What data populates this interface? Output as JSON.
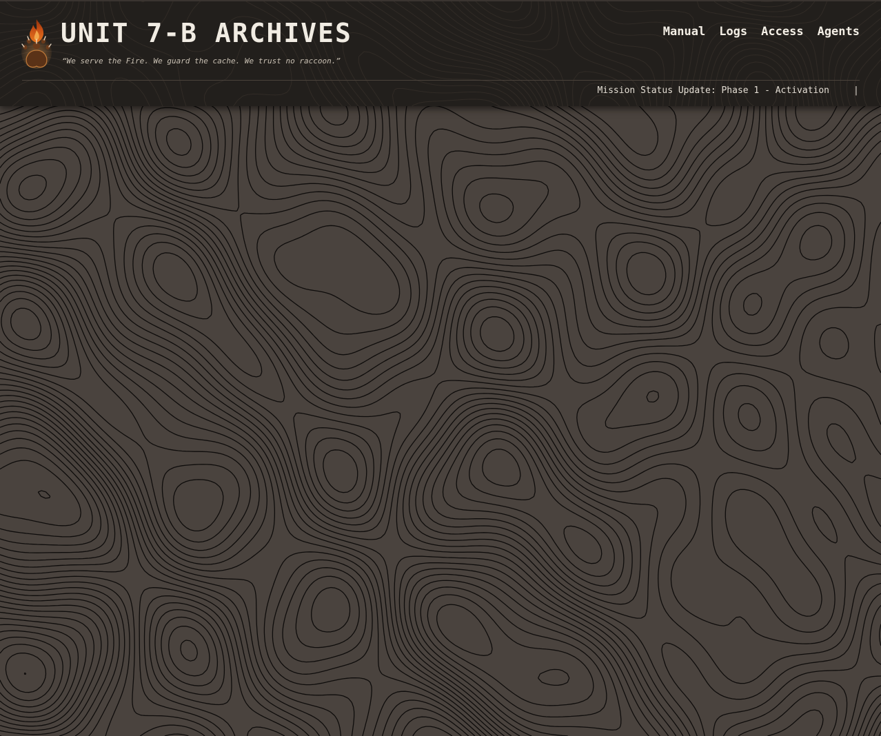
{
  "header": {
    "title": "UNIT 7-B ARCHIVES",
    "tagline": "“We serve the Fire. We guard the cache. We trust no raccoon.”",
    "logo_icon": "flaming-paw-icon"
  },
  "nav": {
    "items": [
      {
        "label": "Manual"
      },
      {
        "label": "Logs"
      },
      {
        "label": "Access"
      },
      {
        "label": "Agents"
      }
    ]
  },
  "ticker": {
    "text": "Mission Status Update: Phase 1 - Activation",
    "separator": "|"
  },
  "colors": {
    "header_bg": "#221f1c",
    "page_bg": "#4a433e",
    "contour_line": "#0e0c0b",
    "flame_accent": "#d9651c",
    "paw_brown": "#5a3217",
    "text_light": "#f1ece3"
  }
}
